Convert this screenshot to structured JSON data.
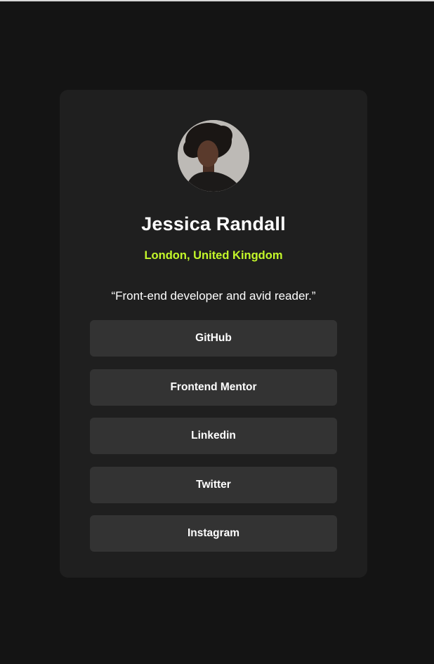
{
  "profile": {
    "name": "Jessica Randall",
    "location": "London, United Kingdom",
    "bio": "“Front-end developer and avid reader.”",
    "avatar_icon": "person-photo-icon"
  },
  "links": [
    {
      "label": "GitHub"
    },
    {
      "label": "Frontend Mentor"
    },
    {
      "label": "Linkedin"
    },
    {
      "label": "Twitter"
    },
    {
      "label": "Instagram"
    }
  ],
  "colors": {
    "page_background": "#141414",
    "card_background": "#1f1f1f",
    "button_background": "#333333",
    "accent": "#c4f82a",
    "text": "#ffffff"
  }
}
